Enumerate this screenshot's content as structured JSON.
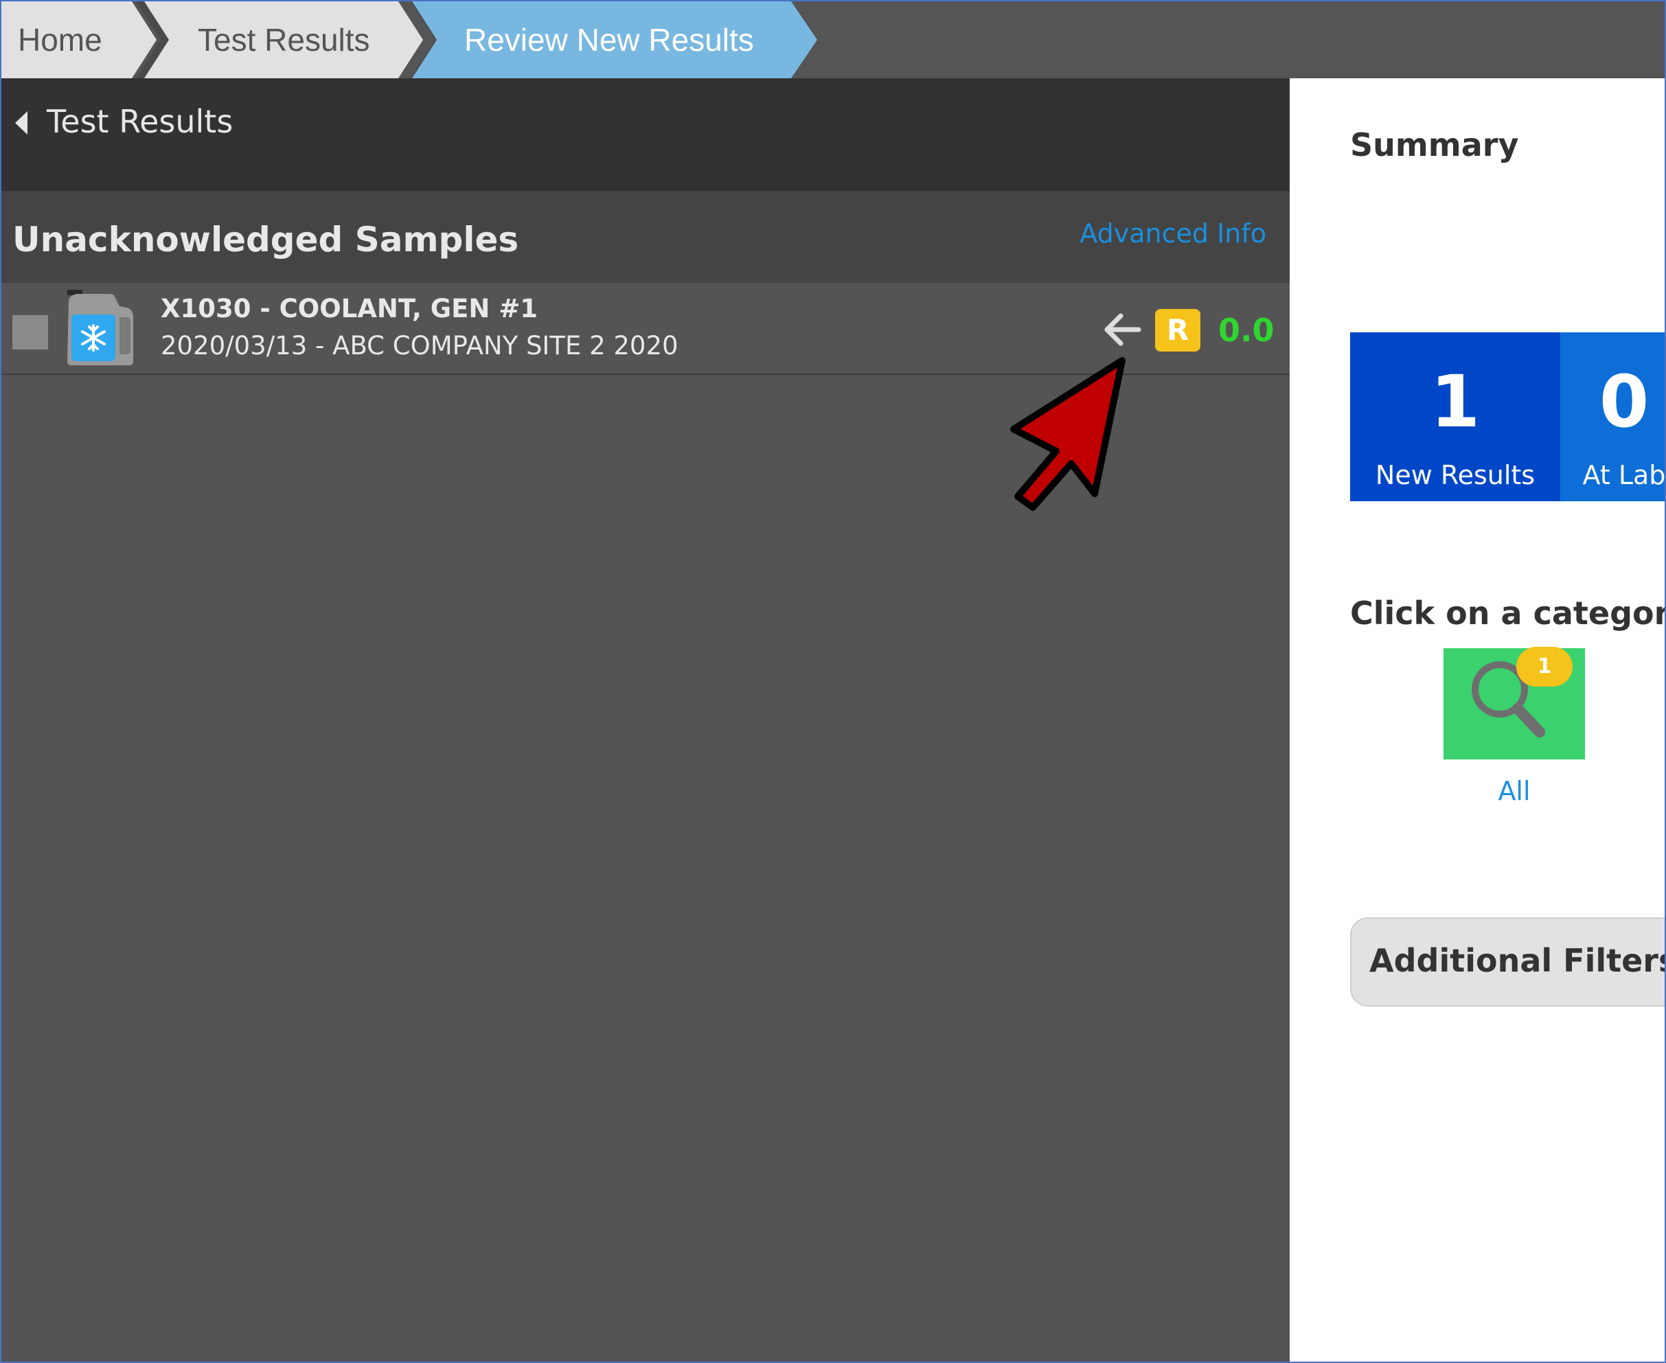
{
  "breadcrumb": {
    "items": [
      {
        "label": "Home"
      },
      {
        "label": "Test Results"
      },
      {
        "label": "Review New Results",
        "active": true
      }
    ],
    "colors": {
      "inactive": "#e1e1e1",
      "active": "#78b8e0",
      "bar": "#555555"
    }
  },
  "left_panel": {
    "back_label": "Test Results",
    "section_title": "Unacknowledged Samples",
    "advanced_link": "Advanced Info",
    "samples": [
      {
        "title": "X1030 - COOLANT, GEN #1",
        "subtitle": "2020/03/13 - ABC COMPANY SITE 2 2020",
        "icon": "coolant-jug-icon",
        "status_badge": "R",
        "score": "0.0",
        "checked": false
      }
    ]
  },
  "summary": {
    "title": "Summary",
    "tiles": [
      {
        "count": "1",
        "label": "New Results",
        "color": "#0047c8"
      },
      {
        "count": "0",
        "label": "At Lab",
        "color": "#0c6ed6"
      }
    ],
    "category_prompt": "Click on a category t",
    "categories": [
      {
        "label": "All",
        "badge": "1",
        "icon": "magnifier-icon",
        "color": "#3ad16e"
      }
    ],
    "filters_label": "Additional Filters"
  },
  "annotation": {
    "pointer_color": "#c00000",
    "pointer_icon": "red-arrow-pointer"
  }
}
